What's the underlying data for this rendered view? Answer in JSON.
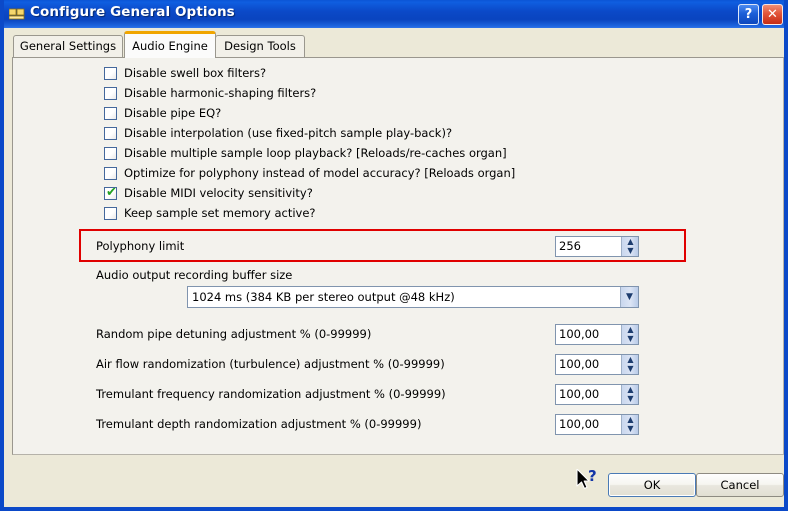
{
  "window": {
    "title": "Configure General Options",
    "icon": "organ-keyboard-icon",
    "help_button_label": "?",
    "close_button_label": "✕",
    "accent_titlebar": "#0b49c8",
    "accent_tab_active": "#f0a500",
    "accent_highlight": "#e00000",
    "dialog_background": "#ece9d8"
  },
  "tabs": [
    {
      "label": "General Settings",
      "active": false
    },
    {
      "label": "Audio Engine",
      "active": true
    },
    {
      "label": "Design Tools",
      "active": false
    }
  ],
  "checkboxes": [
    {
      "label": "Disable swell box filters?",
      "checked": false
    },
    {
      "label": "Disable harmonic-shaping filters?",
      "checked": false
    },
    {
      "label": "Disable pipe EQ?",
      "checked": false
    },
    {
      "label": "Disable interpolation (use fixed-pitch sample play-back)?",
      "checked": false
    },
    {
      "label": "Disable multiple sample loop playback? [Reloads/re-caches organ]",
      "checked": false
    },
    {
      "label": "Optimize for polyphony instead of model accuracy? [Reloads organ]",
      "checked": false
    },
    {
      "label": "Disable MIDI velocity sensitivity?",
      "checked": true
    },
    {
      "label": "Keep sample set memory active?",
      "checked": false
    }
  ],
  "polyphony": {
    "label": "Polyphony limit",
    "value": "256",
    "highlighted": true
  },
  "buffer": {
    "label": "Audio output recording buffer size",
    "selected": "1024 ms (384 KB per stereo output @48 kHz)"
  },
  "numeric_fields": [
    {
      "label": "Random pipe detuning adjustment % (0-99999)",
      "value": "100,00"
    },
    {
      "label": "Air flow randomization (turbulence) adjustment % (0-99999)",
      "value": "100,00"
    },
    {
      "label": "Tremulant frequency randomization adjustment % (0-99999)",
      "value": "100,00"
    },
    {
      "label": "Tremulant depth randomization adjustment % (0-99999)",
      "value": "100,00"
    }
  ],
  "footer": {
    "ok_label": "OK",
    "cancel_label": "Cancel",
    "cursor": "help-pointer-cursor"
  },
  "spinner_arrows": {
    "up": "▲",
    "down": "▼"
  },
  "combo_arrow": "▼"
}
